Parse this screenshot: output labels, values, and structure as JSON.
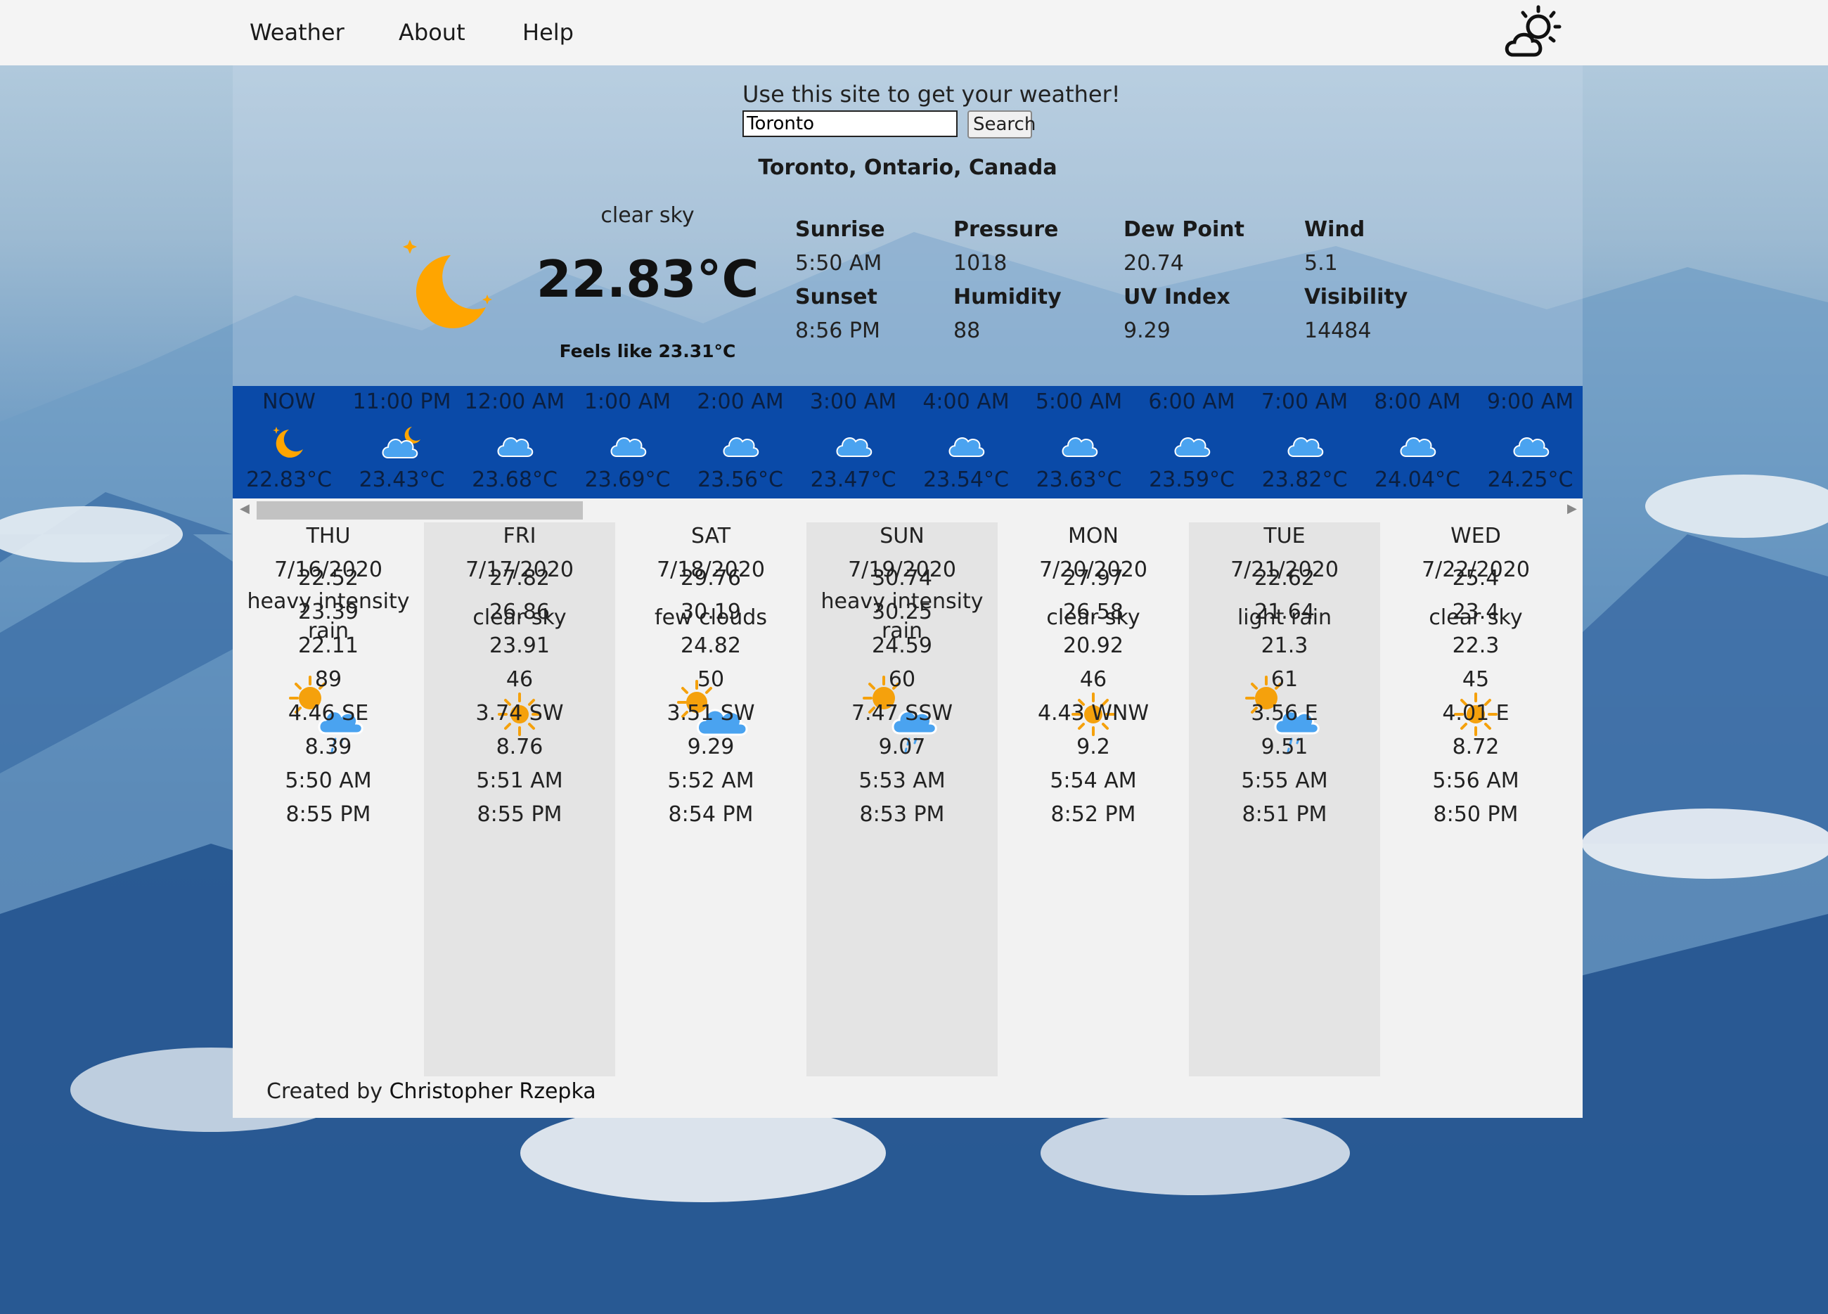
{
  "nav": {
    "items": [
      "Weather",
      "About",
      "Help"
    ],
    "logo_icon": "sun-cloud-icon"
  },
  "hero": {
    "prompt": "Use this site to get your weather!",
    "search": {
      "value": "Toronto",
      "button": "Search"
    },
    "location": "Toronto, Ontario, Canada",
    "condition": "clear sky",
    "icon": "moon-icon",
    "temperature": "22.83°C",
    "feels_like": "Feels like 23.31°C"
  },
  "stats": {
    "sunrise": {
      "label": "Sunrise",
      "value": "5:50 AM"
    },
    "sunset": {
      "label": "Sunset",
      "value": "8:56 PM"
    },
    "pressure": {
      "label": "Pressure",
      "value": "1018"
    },
    "humidity": {
      "label": "Humidity",
      "value": "88"
    },
    "dew_point": {
      "label": "Dew Point",
      "value": "20.74"
    },
    "uv_index": {
      "label": "UV Index",
      "value": "9.29"
    },
    "wind": {
      "label": "Wind",
      "value": "5.1"
    },
    "visibility": {
      "label": "Visibility",
      "value": "14484"
    }
  },
  "hourly": [
    {
      "time": "NOW",
      "temp": "22.83°C",
      "icon": "moon-icon"
    },
    {
      "time": "11:00 PM",
      "temp": "23.43°C",
      "icon": "cloud-moon-icon"
    },
    {
      "time": "12:00 AM",
      "temp": "23.68°C",
      "icon": "cloud-icon"
    },
    {
      "time": "1:00 AM",
      "temp": "23.69°C",
      "icon": "cloud-icon"
    },
    {
      "time": "2:00 AM",
      "temp": "23.56°C",
      "icon": "cloud-icon"
    },
    {
      "time": "3:00 AM",
      "temp": "23.47°C",
      "icon": "cloud-icon"
    },
    {
      "time": "4:00 AM",
      "temp": "23.54°C",
      "icon": "cloud-icon"
    },
    {
      "time": "5:00 AM",
      "temp": "23.63°C",
      "icon": "cloud-icon"
    },
    {
      "time": "6:00 AM",
      "temp": "23.59°C",
      "icon": "cloud-icon"
    },
    {
      "time": "7:00 AM",
      "temp": "23.82°C",
      "icon": "cloud-icon"
    },
    {
      "time": "8:00 AM",
      "temp": "24.04°C",
      "icon": "cloud-icon"
    },
    {
      "time": "9:00 AM",
      "temp": "24.25°C",
      "icon": "cloud-icon"
    }
  ],
  "daily": [
    {
      "day": "THU",
      "date": "7/16/2020",
      "desc": "heavy intensity rain",
      "icon": "sun-rain-cloud-icon",
      "values": [
        "22.52",
        "23.39",
        "22.11",
        "89",
        "4.46 SE",
        "8.39",
        "5:50 AM",
        "8:55 PM"
      ]
    },
    {
      "day": "FRI",
      "date": "7/17/2020",
      "desc": "clear sky",
      "icon": "sun-icon",
      "values": [
        "27.82",
        "26.86",
        "23.91",
        "46",
        "3.74 SW",
        "8.76",
        "5:51 AM",
        "8:55 PM"
      ]
    },
    {
      "day": "SAT",
      "date": "7/18/2020",
      "desc": "few clouds",
      "icon": "sun-cloud-icon",
      "values": [
        "29.76",
        "30.19",
        "24.82",
        "50",
        "3.51 SW",
        "9.29",
        "5:52 AM",
        "8:54 PM"
      ]
    },
    {
      "day": "SUN",
      "date": "7/19/2020",
      "desc": "heavy intensity rain",
      "icon": "sun-rain-cloud-icon",
      "values": [
        "30.74",
        "30.25",
        "24.59",
        "60",
        "7.47 SSW",
        "9.07",
        "5:53 AM",
        "8:53 PM"
      ]
    },
    {
      "day": "MON",
      "date": "7/20/2020",
      "desc": "clear sky",
      "icon": "sun-icon",
      "values": [
        "27.97",
        "26.58",
        "20.92",
        "46",
        "4.43 WNW",
        "9.2",
        "5:54 AM",
        "8:52 PM"
      ]
    },
    {
      "day": "TUE",
      "date": "7/21/2020",
      "desc": "light rain",
      "icon": "sun-rain-cloud-icon",
      "values": [
        "22.62",
        "21.64",
        "21.3",
        "61",
        "3.56 E",
        "9.51",
        "5:55 AM",
        "8:51 PM"
      ]
    },
    {
      "day": "WED",
      "date": "7/22/2020",
      "desc": "clear sky",
      "icon": "sun-icon",
      "values": [
        "25.4",
        "23.4",
        "22.3",
        "45",
        "4.01 E",
        "8.72",
        "5:56 AM",
        "8:50 PM"
      ]
    }
  ],
  "footer": {
    "prefix": "Created by",
    "author": "Christopher Rzepka"
  },
  "colors": {
    "hourly_band": "#0a4aa8",
    "sun": "#f5a10c",
    "moon": "#ffa500",
    "cloud": "#4aa3f0",
    "panel": "#f2f2f2",
    "panel_alt": "#e4e4e4"
  }
}
